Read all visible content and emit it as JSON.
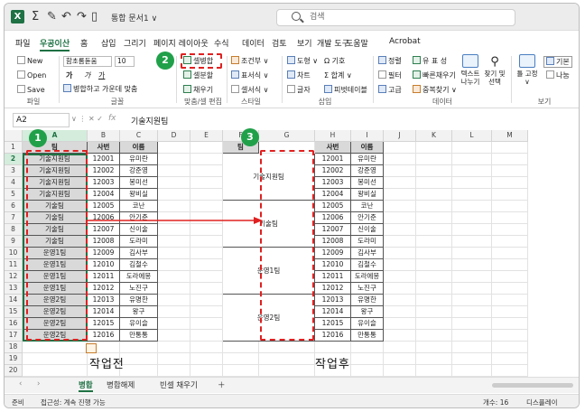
{
  "titlebar": {
    "app_icon": "X",
    "doc_title": "통합 문서1 ∨",
    "search_placeholder": "검색",
    "icon_names": [
      "sum-icon",
      "brush-icon",
      "undo-icon",
      "redo-icon",
      "doc-icon"
    ]
  },
  "menu": [
    "파일",
    "우공이산",
    "홈",
    "삽입",
    "그리기",
    "페이지 레이아웃",
    "수식",
    "데이터",
    "검토",
    "보기",
    "개발 도구",
    "도움말",
    "Acrobat"
  ],
  "ribbon": {
    "file": {
      "new": "New",
      "open": "Open",
      "save": "Save",
      "group": "파일"
    },
    "font": {
      "name": "함초롬돋움",
      "size": "10",
      "bold": "가",
      "italic": "가",
      "strike": "가",
      "mergecenter": "병합하고 가운데 맞춤",
      "group": "글꼴"
    },
    "merge": {
      "unmerge": "셀병합",
      "mergecell": "셀분할",
      "fill": "채우기",
      "group": "맞춤/셀 편집"
    },
    "style": {
      "cond": "조건부",
      "table": "표서식",
      "cellstyle": "셀서식",
      "group": "스타일"
    },
    "insert": {
      "shape": "도형",
      "symbol": "기호",
      "chart": "차트",
      "sum": "합계",
      "text": "글자",
      "pivot": "피벗테이블",
      "group": "삽입"
    },
    "data": {
      "sort": "정렬",
      "unique": "유 표 성",
      "filter": "필터",
      "flashfill": "빠른채우기",
      "adv": "고급",
      "dup": "중복찾기",
      "text_split": "텍스트 나누기",
      "find": "찾기 및 선택",
      "group": "데이터"
    },
    "view": {
      "freeze": "틀 고정",
      "basic": "기본",
      "pagebreak": "나눔",
      "group": "보기"
    }
  },
  "formula_bar": {
    "cell_ref": "A2",
    "fx": "fx",
    "value": "기술지원팀"
  },
  "columns": [
    "A",
    "B",
    "C",
    "D",
    "E",
    "F",
    "G",
    "H",
    "I",
    "J",
    "K",
    "L",
    "M"
  ],
  "rows": [
    "1",
    "2",
    "3",
    "4",
    "5",
    "6",
    "7",
    "8",
    "9",
    "10",
    "11",
    "12",
    "13",
    "14",
    "15",
    "16",
    "17",
    "18",
    "19",
    "20",
    "21"
  ],
  "headers": {
    "team": "팀",
    "id": "사번",
    "name": "이름"
  },
  "before": [
    {
      "team": "기술지원팀",
      "id": "12001",
      "name": "유미란"
    },
    {
      "team": "기술지원팀",
      "id": "12002",
      "name": "강준영"
    },
    {
      "team": "기술지원팀",
      "id": "12003",
      "name": "봉미선"
    },
    {
      "team": "기술지원팀",
      "id": "12004",
      "name": "왕비실"
    },
    {
      "team": "기술팀",
      "id": "12005",
      "name": "코난"
    },
    {
      "team": "기술팀",
      "id": "12006",
      "name": "안기준"
    },
    {
      "team": "기술팀",
      "id": "12007",
      "name": "신이술"
    },
    {
      "team": "기술팀",
      "id": "12008",
      "name": "도라미"
    },
    {
      "team": "운영1팀",
      "id": "12009",
      "name": "김사부"
    },
    {
      "team": "운영1팀",
      "id": "12010",
      "name": "김철수"
    },
    {
      "team": "운영1팀",
      "id": "12011",
      "name": "도라에몽"
    },
    {
      "team": "운영1팀",
      "id": "12012",
      "name": "노진구"
    },
    {
      "team": "운영2팀",
      "id": "12013",
      "name": "유명한"
    },
    {
      "team": "운영2팀",
      "id": "12014",
      "name": "왕구"
    },
    {
      "team": "운영2팀",
      "id": "12015",
      "name": "유이슬"
    },
    {
      "team": "운영2팀",
      "id": "12016",
      "name": "만통통"
    }
  ],
  "after_groups": [
    "기술지원팀",
    "기술팀",
    "운영1팀",
    "운영2팀"
  ],
  "captions": {
    "before": "작업전",
    "after": "작업후"
  },
  "badges": [
    "1",
    "2",
    "3"
  ],
  "sheets": [
    "병합",
    "병합해제",
    "빈셀 채우기"
  ],
  "status": {
    "ready": "준비",
    "access": "접근성: 계속 진행 가능",
    "count": "개수: 16",
    "display": "디스플레이"
  },
  "colors": {
    "accent": "#1f7244",
    "highlight": "#e02020",
    "badge": "#21a04a"
  }
}
